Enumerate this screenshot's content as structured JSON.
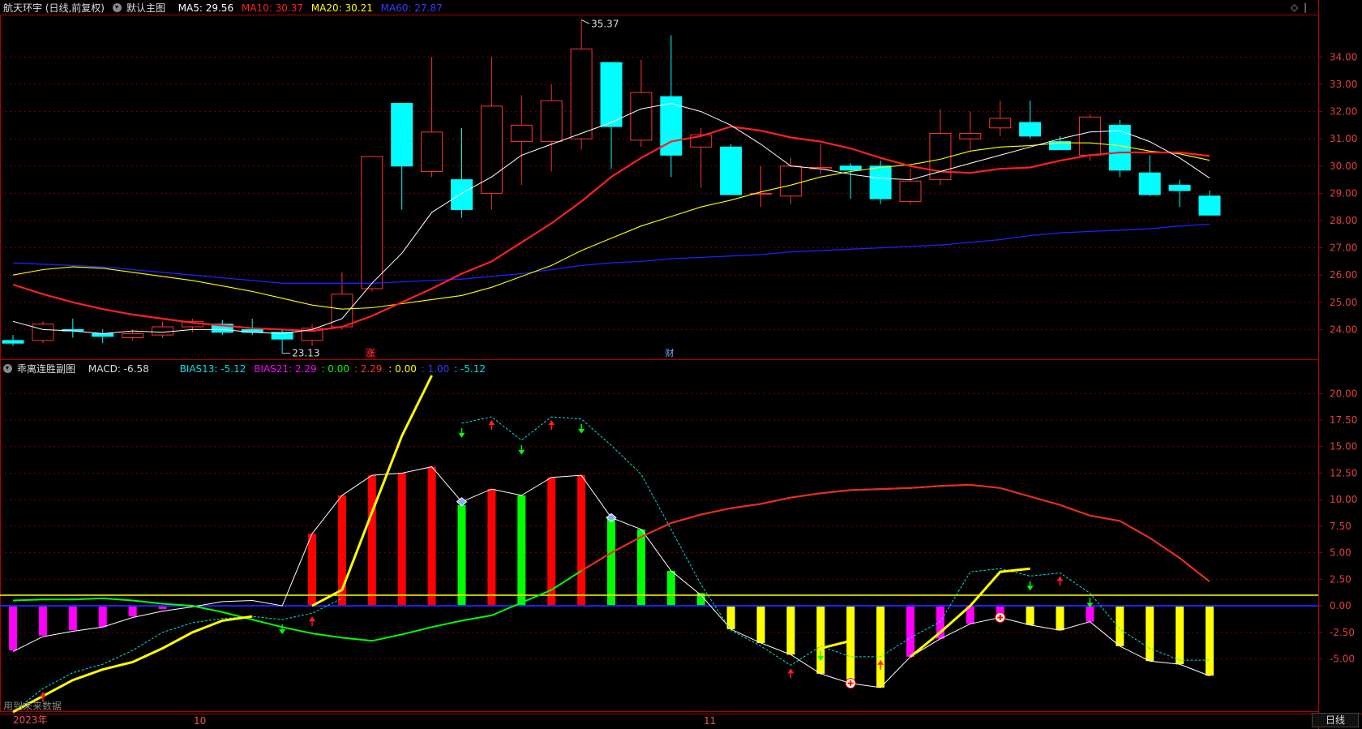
{
  "main_header": {
    "stock": "航天环宇 (日线,前复权)",
    "template": "默认主图",
    "ma5": "MA5: 29.56",
    "ma10": "MA10: 30.37",
    "ma20": "MA20: 30.21",
    "ma60": "MA60: 27.87"
  },
  "sub_header": {
    "indicator": "乖离连胜副图",
    "macd": "MACD: -6.58",
    "bias13": "BIAS13: -5.12",
    "bias21": "BIAS21: 2.29",
    "v0": ": 0.00",
    "v229": ": 2.29",
    "v000": ": 0.00",
    "v100": ": 1.00",
    "v512": ": -5.12"
  },
  "events": {
    "zhang": "涨",
    "cai": "财"
  },
  "status_text": "用到未来数据",
  "period_button": "日线",
  "x_labels": {
    "year": "2023年",
    "m10": "10",
    "m11": "11"
  },
  "colors": {
    "bg": "#000000",
    "frame": "#b00000",
    "up": "#ff3232",
    "down": "#00ffff",
    "ma5": "#ffffff",
    "ma10": "#ff2020",
    "ma20": "#ffff00",
    "ma60": "#2020ff",
    "macd_red": "#ff0000",
    "macd_green": "#00ff00",
    "magenta": "#ff00ff",
    "yellow": "#ffff00"
  },
  "chart_data": [
    {
      "type": "candlestick",
      "title": "航天环宇 (日线,前复权)",
      "ylim": [
        23,
        35.5
      ],
      "yticks": [
        "24.00",
        "25.00",
        "26.00",
        "27.00",
        "28.00",
        "29.00",
        "30.00",
        "31.00",
        "32.00",
        "33.00",
        "34.00"
      ],
      "annotations": [
        {
          "text": "35.37",
          "at": "high"
        },
        {
          "text": "23.13",
          "at": "low"
        }
      ],
      "candles": [
        {
          "o": 23.6,
          "h": 23.8,
          "l": 23.4,
          "c": 23.5
        },
        {
          "o": 23.6,
          "h": 24.3,
          "l": 23.5,
          "c": 24.2
        },
        {
          "o": 24.0,
          "h": 24.4,
          "l": 23.7,
          "c": 23.95
        },
        {
          "o": 23.85,
          "h": 24.0,
          "l": 23.5,
          "c": 23.75
        },
        {
          "o": 23.7,
          "h": 24.0,
          "l": 23.6,
          "c": 23.85
        },
        {
          "o": 23.8,
          "h": 24.3,
          "l": 23.7,
          "c": 24.1
        },
        {
          "o": 24.1,
          "h": 24.4,
          "l": 23.9,
          "c": 24.3
        },
        {
          "o": 24.2,
          "h": 24.35,
          "l": 23.8,
          "c": 23.9
        },
        {
          "o": 24.0,
          "h": 24.4,
          "l": 23.8,
          "c": 23.9
        },
        {
          "o": 23.9,
          "h": 24.0,
          "l": 23.13,
          "c": 23.65
        },
        {
          "o": 23.6,
          "h": 24.2,
          "l": 23.4,
          "c": 24.05
        },
        {
          "o": 24.1,
          "h": 26.1,
          "l": 24.0,
          "c": 25.3
        },
        {
          "o": 25.5,
          "h": 30.35,
          "l": 25.4,
          "c": 30.35
        },
        {
          "o": 32.3,
          "h": 32.3,
          "l": 28.4,
          "c": 30.0
        },
        {
          "o": 29.8,
          "h": 34.0,
          "l": 29.6,
          "c": 31.25
        },
        {
          "o": 29.5,
          "h": 31.4,
          "l": 28.1,
          "c": 28.4
        },
        {
          "o": 29.0,
          "h": 34.0,
          "l": 28.4,
          "c": 32.2
        },
        {
          "o": 30.9,
          "h": 32.6,
          "l": 29.3,
          "c": 31.5
        },
        {
          "o": 30.9,
          "h": 33.0,
          "l": 29.8,
          "c": 32.4
        },
        {
          "o": 31.0,
          "h": 35.37,
          "l": 30.6,
          "c": 34.3
        },
        {
          "o": 33.8,
          "h": 33.8,
          "l": 29.9,
          "c": 31.45
        },
        {
          "o": 30.95,
          "h": 33.9,
          "l": 30.7,
          "c": 32.7
        },
        {
          "o": 32.55,
          "h": 34.8,
          "l": 29.6,
          "c": 30.4
        },
        {
          "o": 30.7,
          "h": 31.4,
          "l": 29.2,
          "c": 31.15
        },
        {
          "o": 30.7,
          "h": 30.8,
          "l": 29.1,
          "c": 28.95
        },
        {
          "o": 29.0,
          "h": 30.0,
          "l": 28.5,
          "c": 29.0
        },
        {
          "o": 28.9,
          "h": 30.3,
          "l": 28.6,
          "c": 30.0
        },
        {
          "o": 29.9,
          "h": 30.8,
          "l": 29.7,
          "c": 29.95
        },
        {
          "o": 30.0,
          "h": 30.1,
          "l": 28.8,
          "c": 29.85
        },
        {
          "o": 30.0,
          "h": 30.2,
          "l": 28.6,
          "c": 28.8
        },
        {
          "o": 28.7,
          "h": 29.9,
          "l": 28.6,
          "c": 29.45
        },
        {
          "o": 29.5,
          "h": 32.1,
          "l": 29.3,
          "c": 31.2
        },
        {
          "o": 31.0,
          "h": 32.0,
          "l": 30.6,
          "c": 31.2
        },
        {
          "o": 31.4,
          "h": 32.4,
          "l": 31.1,
          "c": 31.75
        },
        {
          "o": 31.6,
          "h": 32.4,
          "l": 31.0,
          "c": 31.1
        },
        {
          "o": 30.9,
          "h": 31.1,
          "l": 30.6,
          "c": 30.6
        },
        {
          "o": 30.4,
          "h": 31.9,
          "l": 30.2,
          "c": 31.8
        },
        {
          "o": 31.5,
          "h": 31.7,
          "l": 29.6,
          "c": 29.85
        },
        {
          "o": 29.75,
          "h": 30.4,
          "l": 28.9,
          "c": 28.95
        },
        {
          "o": 29.3,
          "h": 29.5,
          "l": 28.5,
          "c": 29.1
        },
        {
          "o": 28.9,
          "h": 29.1,
          "l": 28.2,
          "c": 28.2
        }
      ],
      "ma5": [
        24.3,
        24.0,
        23.95,
        23.85,
        23.95,
        23.9,
        24.0,
        24.0,
        23.9,
        23.85,
        24.0,
        24.4,
        25.7,
        26.8,
        28.3,
        29.0,
        29.6,
        30.4,
        30.8,
        31.2,
        31.6,
        32.1,
        32.3,
        32.0,
        31.5,
        30.8,
        30.0,
        29.9,
        29.7,
        29.55,
        29.5,
        29.8,
        30.1,
        30.4,
        30.7,
        31.0,
        31.25,
        31.3,
        30.9,
        30.3,
        29.56
      ],
      "ma10": [
        25.65,
        25.3,
        25.0,
        24.75,
        24.55,
        24.4,
        24.25,
        24.15,
        24.05,
        24.0,
        23.95,
        24.1,
        24.5,
        25.0,
        25.5,
        26.05,
        26.5,
        27.2,
        27.9,
        28.7,
        29.6,
        30.3,
        30.9,
        31.1,
        31.45,
        31.3,
        31.05,
        30.9,
        30.65,
        30.3,
        30.0,
        29.8,
        29.75,
        29.9,
        29.95,
        30.2,
        30.4,
        30.5,
        30.5,
        30.5,
        30.37
      ],
      "ma20": [
        26.0,
        26.2,
        26.3,
        26.25,
        26.1,
        25.95,
        25.8,
        25.6,
        25.4,
        25.15,
        24.9,
        24.75,
        24.8,
        24.95,
        25.1,
        25.25,
        25.55,
        25.95,
        26.35,
        26.9,
        27.35,
        27.8,
        28.15,
        28.5,
        28.75,
        29.05,
        29.3,
        29.6,
        29.8,
        29.95,
        30.05,
        30.25,
        30.55,
        30.7,
        30.75,
        30.85,
        30.85,
        30.75,
        30.55,
        30.45,
        30.21
      ],
      "ma60": [
        26.45,
        26.4,
        26.35,
        26.3,
        26.2,
        26.1,
        26.0,
        25.9,
        25.8,
        25.7,
        25.7,
        25.7,
        25.7,
        25.75,
        25.8,
        25.85,
        25.95,
        26.05,
        26.2,
        26.35,
        26.45,
        26.5,
        26.6,
        26.65,
        26.7,
        26.75,
        26.85,
        26.9,
        26.95,
        27.0,
        27.05,
        27.1,
        27.2,
        27.3,
        27.45,
        27.55,
        27.6,
        27.65,
        27.7,
        27.8,
        27.87
      ]
    },
    {
      "type": "bar",
      "title": "乖离连胜副图",
      "ylim": [
        -10.0,
        23.0
      ],
      "yticks": [
        "-5.00",
        "-2.50",
        "0.00",
        "2.50",
        "5.00",
        "7.50",
        "10.00",
        "12.50",
        "15.00",
        "17.50",
        "20.00"
      ],
      "macd_bars": [
        -4.2,
        -2.8,
        -2.3,
        -2.0,
        -1.0,
        -0.3,
        0.0,
        0.0,
        0.0,
        0.0,
        6.8,
        10.4,
        12.3,
        12.5,
        13.1,
        9.5,
        11.0,
        10.4,
        12.1,
        12.3,
        8.3,
        7.2,
        3.3,
        1.2,
        -2.2,
        -3.5,
        -4.6,
        -6.4,
        -7.3,
        -7.7,
        -4.8,
        -3.1,
        -1.7,
        -1.1,
        -1.8,
        -2.3,
        -1.5,
        -3.8,
        -5.2,
        -5.5,
        -6.58
      ],
      "macd_bar_colors": [
        "magenta",
        "magenta",
        "magenta",
        "magenta",
        "magenta",
        "magenta",
        "none",
        "none",
        "none",
        "none",
        "red",
        "red",
        "red",
        "red",
        "red",
        "green",
        "red",
        "green",
        "red",
        "red",
        "green",
        "green",
        "green",
        "green",
        "yellow",
        "yellow",
        "yellow",
        "yellow",
        "yellow",
        "yellow",
        "magenta",
        "magenta",
        "magenta",
        "magenta",
        "yellow",
        "yellow",
        "magenta",
        "yellow",
        "yellow",
        "yellow",
        "yellow"
      ],
      "dif_line": [
        -4.3,
        -2.9,
        -2.4,
        -2.0,
        -1.1,
        -0.5,
        -0.1,
        0.4,
        0.5,
        0.0,
        6.8,
        10.4,
        12.3,
        12.5,
        13.1,
        9.8,
        11.0,
        10.4,
        12.1,
        12.3,
        8.3,
        7.2,
        3.3,
        1.0,
        -2.2,
        -3.5,
        -4.6,
        -6.4,
        -7.3,
        -7.7,
        -4.8,
        -3.1,
        -1.7,
        -1.1,
        -1.8,
        -2.3,
        -1.5,
        -3.8,
        -5.2,
        -5.5,
        -6.6
      ],
      "bias13": [
        -10.0,
        -7.8,
        -6.3,
        -5.5,
        -4.2,
        -2.5,
        -1.6,
        -1.2,
        -1.0,
        -1.3,
        -0.7,
        0.7,
        null,
        null,
        null,
        17.2,
        17.8,
        15.6,
        17.8,
        17.6,
        15.1,
        12.4,
        7.2,
        2.0,
        -2.3,
        -3.8,
        -5.6,
        -3.8,
        -4.8,
        -4.8,
        -3.0,
        -1.5,
        3.2,
        3.5,
        2.8,
        3.1,
        1.2,
        -2.2,
        -4.0,
        -5.12,
        -5.12
      ],
      "bias21": [
        0.5,
        0.6,
        0.6,
        0.7,
        0.5,
        0.2,
        0.0,
        -0.6,
        -1.3,
        -2.0,
        -2.6,
        -3.0,
        -3.3,
        -2.7,
        -2.0,
        -1.4,
        -0.9,
        0.3,
        1.5,
        3.3,
        5.0,
        6.5,
        7.8,
        8.6,
        9.2,
        9.6,
        10.2,
        10.6,
        10.9,
        11.0,
        11.1,
        11.3,
        11.4,
        11.1,
        10.3,
        9.5,
        8.5,
        8.0,
        6.4,
        4.5,
        2.29
      ],
      "yellow_line": [
        -10.0,
        -8.5,
        -7.0,
        -6.0,
        -5.3,
        -4.0,
        -2.5,
        -1.4,
        -1.0,
        null,
        0.0,
        1.5,
        8.8,
        16.0,
        21.7,
        null,
        null,
        null,
        null,
        null,
        null,
        null,
        null,
        null,
        null,
        null,
        null,
        -4.0,
        -3.3,
        null,
        -4.8,
        -2.5,
        0.0,
        3.2,
        3.5,
        null,
        null,
        null,
        null,
        null,
        null
      ],
      "level_yellow": 1.0,
      "level_blue": 0.0
    }
  ]
}
